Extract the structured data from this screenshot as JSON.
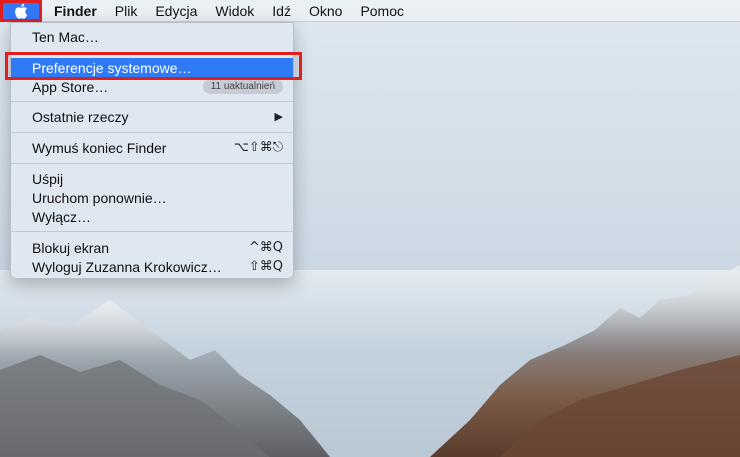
{
  "menubar": {
    "apple_icon": "apple-logo-icon",
    "app_name": "Finder",
    "items": [
      "Plik",
      "Edycja",
      "Widok",
      "Idź",
      "Okno",
      "Pomoc"
    ]
  },
  "apple_menu": {
    "about": "Ten Mac…",
    "system_preferences": "Preferencje systemowe…",
    "app_store": "App Store…",
    "app_store_badge": "11 uaktualnień",
    "recent_items": "Ostatnie rzeczy",
    "recent_items_arrow": "▶",
    "force_quit": "Wymuś koniec Finder",
    "force_quit_shortcut": "⌥⇧⌘⎋",
    "sleep": "Uśpij",
    "restart": "Uruchom ponownie…",
    "shutdown": "Wyłącz…",
    "lock_screen": "Blokuj ekran",
    "lock_screen_shortcut": "^⌘Q",
    "logout": "Wyloguj Zuzanna Krokowicz…",
    "logout_shortcut": "⇧⌘Q"
  },
  "colors": {
    "selection": "#2f7bf5",
    "annotation_red": "#e02020"
  }
}
